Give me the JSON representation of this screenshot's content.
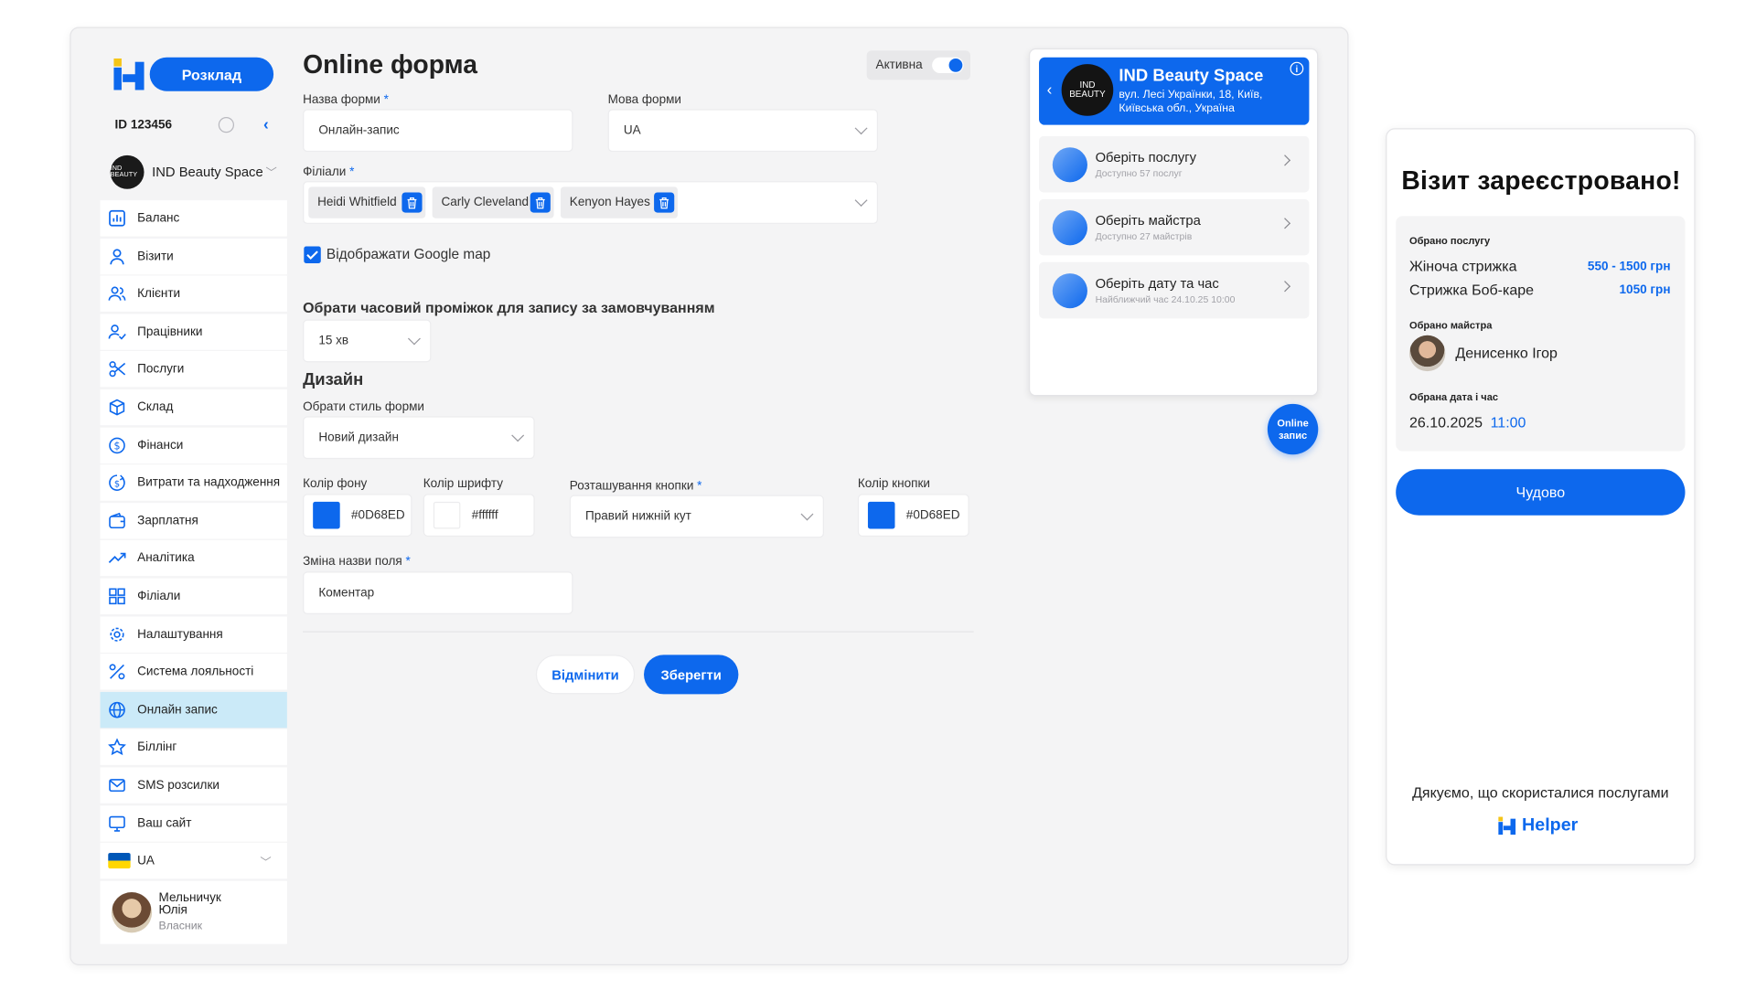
{
  "sidebar": {
    "schedule_button": "Розклад",
    "id_label": "ID 123456",
    "salon_name": "IND Beauty Space",
    "salon_logo_text": "IND BEAUTY",
    "items": [
      {
        "label": "Баланс",
        "icon": "balance-chart-icon"
      },
      {
        "label": "Візити",
        "icon": "person-icon"
      },
      {
        "label": "Клієнти",
        "icon": "people-icon"
      },
      {
        "label": "Працівники",
        "icon": "person-check-icon"
      },
      {
        "label": "Послуги",
        "icon": "scissors-icon"
      },
      {
        "label": "Склад",
        "icon": "box-icon"
      },
      {
        "label": "Фінанси",
        "icon": "dollar-circle-icon"
      },
      {
        "label": "Витрати та надходження",
        "icon": "money-flow-icon"
      },
      {
        "label": "Зарплатня",
        "icon": "wallet-icon"
      },
      {
        "label": "Аналітика",
        "icon": "trend-icon"
      },
      {
        "label": "Філіали",
        "icon": "grid-icon"
      },
      {
        "label": "Налаштування",
        "icon": "gear-icon"
      },
      {
        "label": "Система лояльності",
        "icon": "percent-icon"
      },
      {
        "label": "Онлайн запис",
        "icon": "globe-icon",
        "active": true
      },
      {
        "label": "Біллінг",
        "icon": "star-icon"
      },
      {
        "label": "SMS розсилки",
        "icon": "mail-icon"
      },
      {
        "label": "Ваш сайт",
        "icon": "monitor-icon"
      }
    ],
    "language": "UA",
    "user": {
      "name": "Мельничук Юлія",
      "role": "Власник"
    }
  },
  "form": {
    "title": "Online форма",
    "active_label": "Активна",
    "active": true,
    "form_name_label": "Назва форми",
    "form_name_value": "Онлайн-запис",
    "form_lang_label": "Мова форми",
    "form_lang_value": "UA",
    "branches_label": "Філіали",
    "branches": [
      "Heidi Whitfield",
      "Carly Cleveland",
      "Kenyon Hayes"
    ],
    "google_map_label": "Відображати Google map",
    "google_map_checked": true,
    "interval_title": "Обрати часовий проміжок для запису за замовчуванням",
    "interval_value": "15 хв",
    "design_title": "Дизайн",
    "style_label": "Обрати стиль форми",
    "style_value": "Новий дизайн",
    "bg_color_label": "Колір фону",
    "bg_color_value": "#0D68ED",
    "font_color_label": "Колір шрифту",
    "font_color_value": "#ffffff",
    "button_pos_label": "Розташування кнопки",
    "button_pos_value": "Правий нижній кут",
    "button_color_label": "Колір кнопки",
    "button_color_value": "#0D68ED",
    "field_rename_label": "Зміна назви поля",
    "field_rename_value": "Коментар",
    "cancel_button": "Відмінити",
    "save_button": "Зберегти",
    "required_mark": "*"
  },
  "preview": {
    "salon_name": "IND Beauty Space",
    "logo_text": "IND BEAUTY",
    "address": "вул. Лесі Українки, 18, Київ, Київська обл., Україна",
    "items": [
      {
        "title": "Оберіть послугу",
        "subtitle": "Доступно 57 послуг"
      },
      {
        "title": "Оберіть майстра",
        "subtitle": "Доступно 27 майстрів"
      },
      {
        "title": "Оберіть дату та час",
        "subtitle": "Найближчий час  24.10.25 10:00"
      }
    ],
    "online_button": "Online запис"
  },
  "confirmation": {
    "title": "Візит зареєстровано!",
    "service_label": "Обрано послугу",
    "services": [
      {
        "name": "Жіноча стрижка",
        "price": "550 - 1500 грн"
      },
      {
        "name": "Стрижка Боб-каре",
        "price": "1050 грн"
      }
    ],
    "master_label": "Обрано майстра",
    "master_name": "Денисенко Ігор",
    "datetime_label": "Обрана дата і час",
    "date": "26.10.2025",
    "time": "11:00",
    "ok_button": "Чудово",
    "thanks": "Дякуємо, що скористалися послугами",
    "brand": "Helper"
  },
  "colors": {
    "accent": "#0D68ED",
    "active_menu_bg": "#cbeaf8",
    "page_bg": "#f4f4f5"
  }
}
